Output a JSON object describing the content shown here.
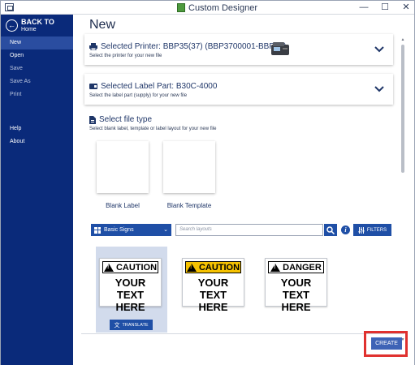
{
  "window": {
    "title": "Custom Designer",
    "minimize_glyph": "—",
    "maximize_glyph": "☐",
    "close_glyph": "✕"
  },
  "sidebar": {
    "back_title": "BACK TO",
    "back_sub": "Home",
    "items": [
      {
        "label": "New"
      },
      {
        "label": "Open"
      },
      {
        "label": "Save"
      },
      {
        "label": "Save As"
      },
      {
        "label": "Print"
      },
      {
        "label": "Help"
      },
      {
        "label": "About"
      }
    ]
  },
  "main": {
    "title": "New",
    "printer": {
      "title": "Selected Printer: BBP35(37) (BBP3700001-BBP37)",
      "subtitle": "Select the printer for your new file"
    },
    "label_part": {
      "title": "Selected Label Part: B30C-4000",
      "subtitle": "Select the label part (supply) for your new file"
    },
    "file_type": {
      "title": "Select file type",
      "subtitle": "Select blank label, template or label layout for your new file",
      "options": [
        {
          "label": "Blank Label"
        },
        {
          "label": "Blank Template"
        }
      ]
    },
    "toolbar": {
      "category": "Basic Signs",
      "search_placeholder": "Search layouts",
      "info_glyph": "i",
      "filters_label": "FILTERS"
    },
    "layouts": [
      {
        "header": "CAUTION",
        "body1": "YOUR",
        "body2": "TEXT HERE",
        "header_color": "#ffffff"
      },
      {
        "header": "CAUTION",
        "body1": "YOUR",
        "body2": "TEXT HERE",
        "header_color": "#f6c200"
      },
      {
        "header": "DANGER",
        "body1": "YOUR",
        "body2": "TEXT HERE",
        "header_color": "#ffffff"
      }
    ],
    "translate_label": "TRANSLATE",
    "create_label": "CREATE"
  },
  "colors": {
    "sidebar_bg": "#0a2a7a",
    "accent": "#1f4fa6",
    "highlight": "#e0312f",
    "caution_yellow": "#f6c200"
  }
}
